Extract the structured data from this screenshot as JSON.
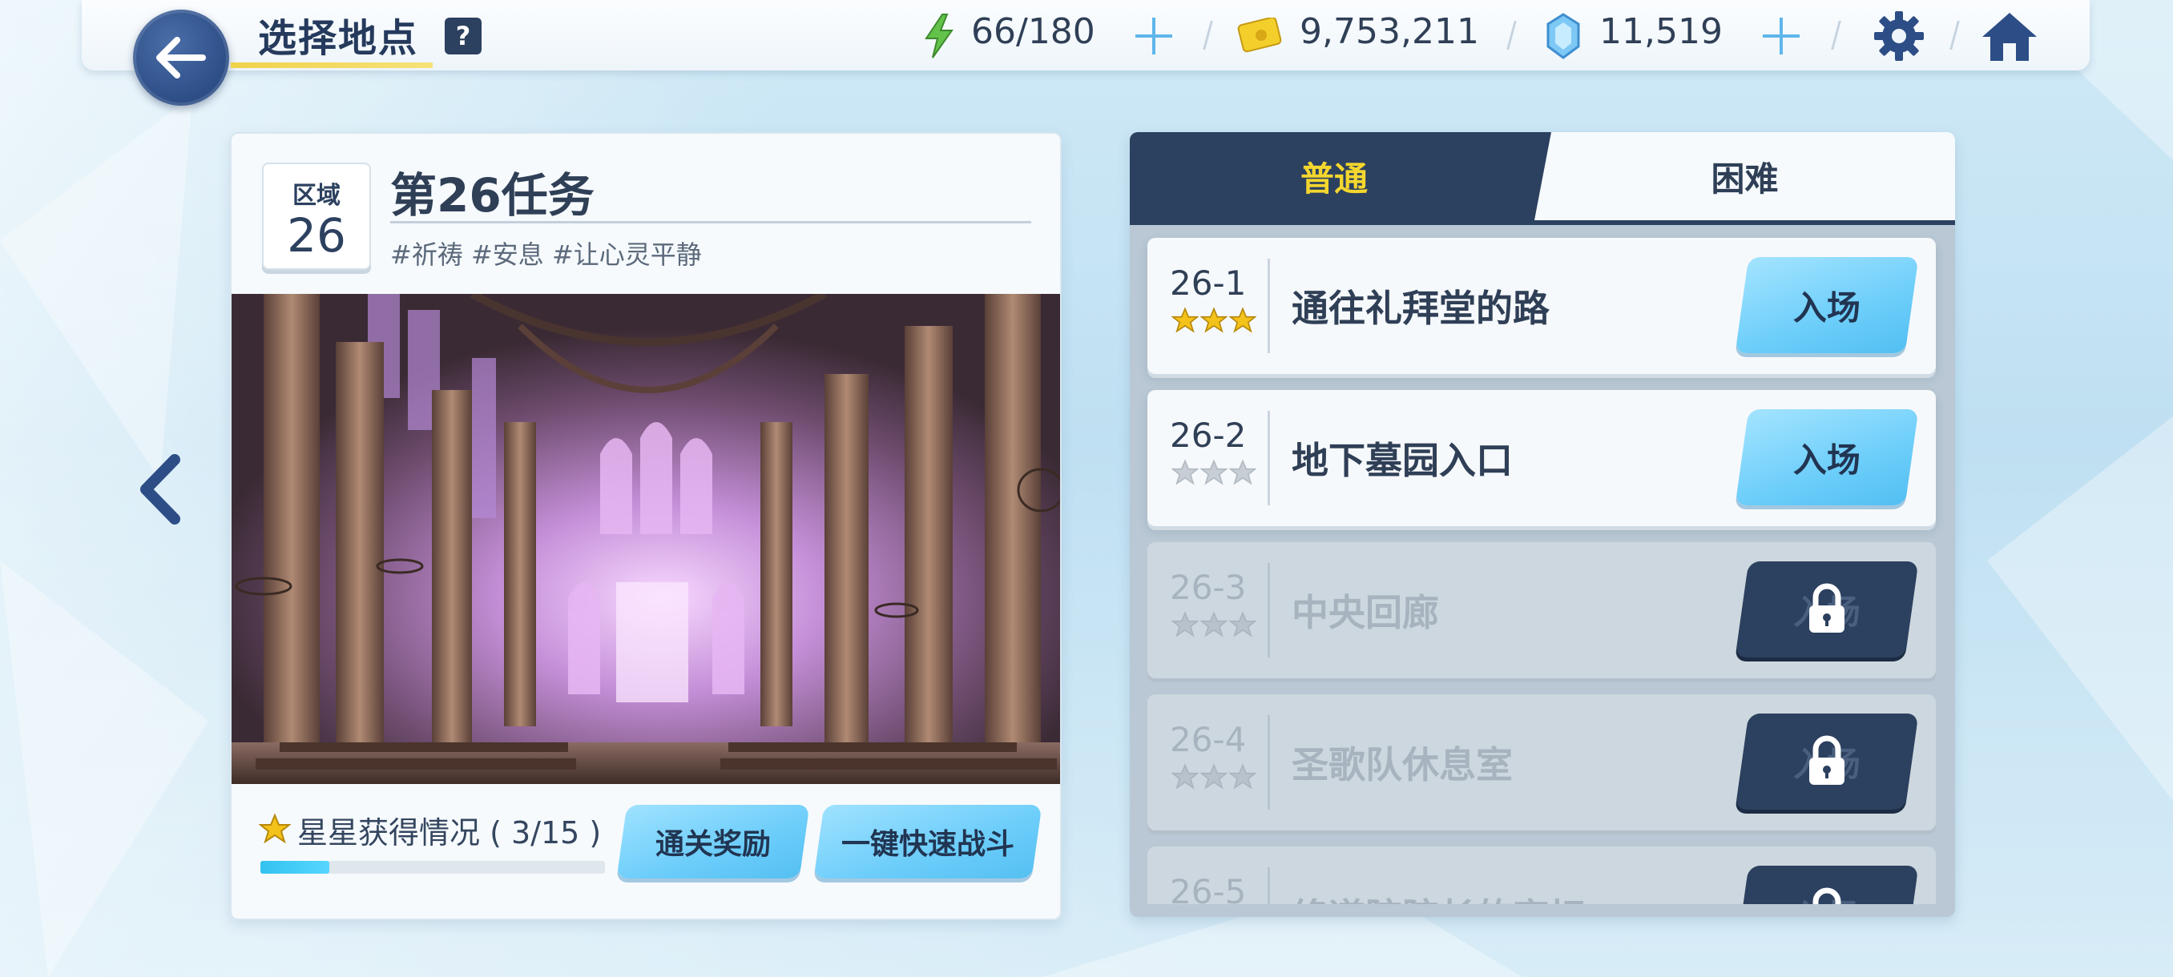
{
  "header": {
    "title": "选择地点",
    "help_label": "?",
    "energy": "66/180",
    "credits": "9,753,211",
    "gems": "11,519"
  },
  "mission": {
    "area_label": "区域",
    "area_number": "26",
    "title": "第26任务",
    "tags": "#祈祷 #安息 #让心灵平静",
    "stars_label": "星星获得情况 ( 3/15 )",
    "stars_progress_fraction": 0.2,
    "reward_button": "通关奖励",
    "quick_battle_button": "一键快速战斗"
  },
  "tabs": {
    "normal": "普通",
    "hard": "困难",
    "active": "normal"
  },
  "stages": [
    {
      "code": "26-1",
      "name": "通往礼拜堂的路",
      "stars": 3,
      "locked": false,
      "button": "入场"
    },
    {
      "code": "26-2",
      "name": "地下墓园入口",
      "stars": 0,
      "locked": false,
      "button": "入场"
    },
    {
      "code": "26-3",
      "name": "中央回廊",
      "stars": 0,
      "locked": true,
      "button": "入场"
    },
    {
      "code": "26-4",
      "name": "圣歌队休息室",
      "stars": 0,
      "locked": true,
      "button": "入场"
    },
    {
      "code": "26-5",
      "name": "终道院院长的牢坛",
      "stars": 0,
      "locked": true,
      "button": "入场"
    }
  ],
  "colors": {
    "accent_dark": "#2c405f",
    "accent_yellow": "#f4d62e",
    "button_blue": "#6dcefa",
    "star_gold": "#f3c21b"
  }
}
